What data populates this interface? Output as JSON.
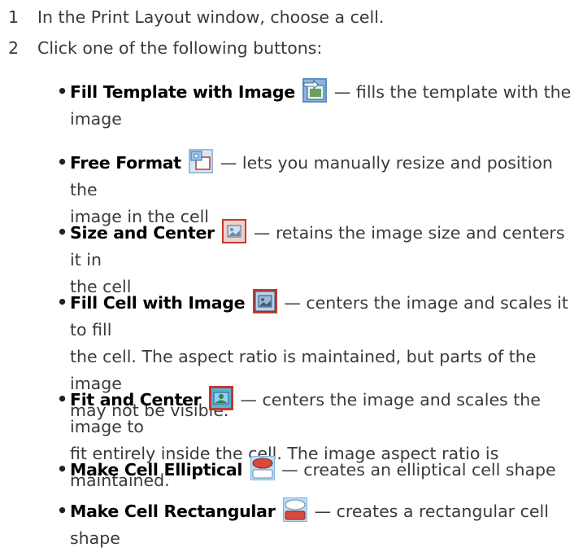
{
  "steps": [
    {
      "number": "1",
      "text": "In the Print Layout window, choose a cell."
    },
    {
      "number": "2",
      "text": "Click one of the following buttons:"
    }
  ],
  "bullet_symbol": "•",
  "dash": "—",
  "buttons": [
    {
      "term": "Fill Template with Image",
      "icon": "fill-template-icon",
      "desc_line1": "fills the template with the",
      "desc_line2": "image"
    },
    {
      "term": "Free Format",
      "icon": "free-format-icon",
      "desc_line1": "lets you manually resize and position the",
      "desc_line2": "image in the cell"
    },
    {
      "term": "Size and Center",
      "icon": "size-and-center-icon",
      "desc_line1": "retains the image size and centers it in",
      "desc_line2": "the cell"
    },
    {
      "term": "Fill Cell with Image",
      "icon": "fill-cell-icon",
      "desc_line1": "centers the image and scales it to fill",
      "desc_line2": "the cell. The aspect ratio is maintained, but parts of the image",
      "desc_line3": "may not be visible."
    },
    {
      "term": "Fit and Center",
      "icon": "fit-and-center-icon",
      "desc_line1": "centers the image and scales the image to",
      "desc_line2": "fit entirely inside the cell. The image aspect ratio is maintained."
    },
    {
      "term": "Make Cell Elliptical",
      "icon": "ellipse-cell-icon",
      "desc_line1": "creates an elliptical cell shape"
    },
    {
      "term": "Make Cell Rectangular",
      "icon": "rectangle-cell-icon",
      "desc_line1": "creates a rectangular cell shape"
    }
  ]
}
